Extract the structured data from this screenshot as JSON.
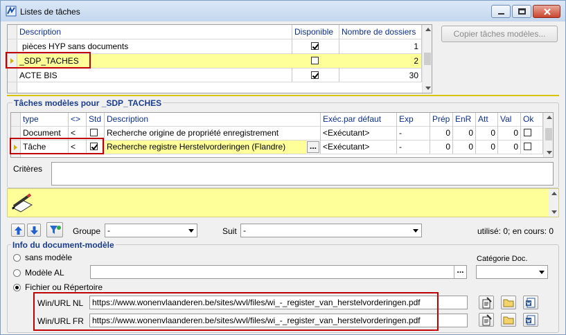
{
  "window": {
    "title": "Listes de tâches"
  },
  "tasklists": {
    "columns": [
      "Description",
      "Disponible",
      "Nombre de dossiers"
    ],
    "rows": [
      {
        "description": "pièces HYP sans documents",
        "available": true,
        "count": "1"
      },
      {
        "description": "_SDP_TACHES",
        "available": false,
        "count": "2"
      },
      {
        "description": "ACTE BIS",
        "available": true,
        "count": "30"
      }
    ]
  },
  "copy_button": "Copier tâches modèles...",
  "models": {
    "section_label": "Tâches modèles pour _SDP_TACHES",
    "columns": [
      "type",
      "<>",
      "Std",
      "Description",
      "Exéc.par défaut",
      "Exp",
      "Prép",
      "EnR",
      "Att",
      "Val",
      "Ok"
    ],
    "rows": [
      {
        "type": "Document",
        "cmp": "<",
        "std": false,
        "description": "Recherche origine de propriété enregistrement",
        "exec": "<Exécutant>",
        "exp": "-",
        "prep": "0",
        "enr": "0",
        "att": "0",
        "val": "0",
        "ok": false
      },
      {
        "type": "Tâche",
        "cmp": "<",
        "std": true,
        "description": "Recherche registre Herstelvorderingen (Flandre)",
        "exec": "<Exécutant>",
        "exp": "-",
        "prep": "0",
        "enr": "0",
        "att": "0",
        "val": "0",
        "ok": false
      }
    ],
    "ellipsis": "..."
  },
  "criteria": {
    "label": "Critères",
    "value": ""
  },
  "toolbar": {
    "group_label": "Groupe",
    "group_value": "-",
    "next_label": "Suit",
    "next_value": "-",
    "usage": "utilisé: 0; en cours: 0"
  },
  "docinfo": {
    "section_label": "Info du document-modèle",
    "radio_none": "sans modèle",
    "radio_al": "Modèle AL",
    "radio_file": "Fichier ou Répertoire",
    "al_value": "",
    "al_ellipsis": "...",
    "category_label": "Catégorie Doc.",
    "category_value": "",
    "url_nl_label": "Win/URL NL",
    "url_nl_value": "https://www.wonenvlaanderen.be/sites/wvl/files/wi_-_register_van_herstelvorderingen.pdf",
    "url_fr_label": "Win/URL FR",
    "url_fr_value": "https://www.wonenvlaanderen.be/sites/wvl/files/wi_-_register_van_herstelvorderingen.pdf"
  },
  "colors": {
    "highlight": "#ffff99",
    "accent_red": "#c00000",
    "header_blue": "#0b2f8f"
  }
}
